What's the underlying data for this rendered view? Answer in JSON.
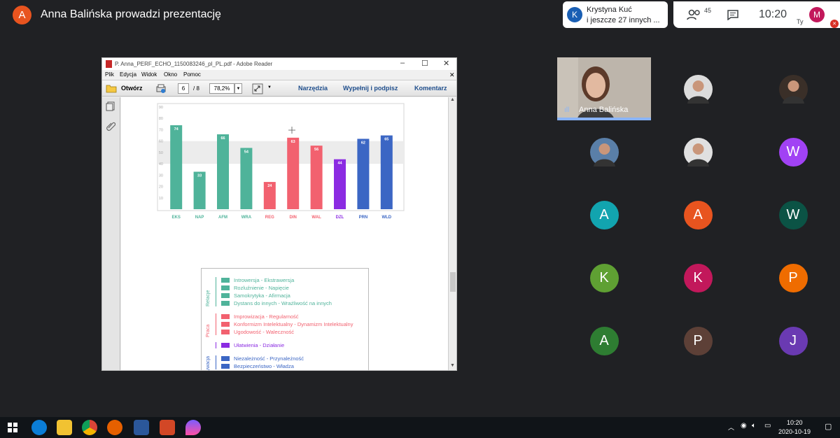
{
  "meet": {
    "presenter_initial": "A",
    "presenter_text": "Anna Balińska prowadzi prezentację",
    "notification": {
      "initial": "K",
      "line1": "Krystyna Kuć",
      "line2": "i jeszcze 27 innych ..."
    },
    "people_count": "45",
    "clock": "10:20",
    "self_initial": "M",
    "self_label": "Ty"
  },
  "reader": {
    "title": "P. Anna_PERF_ECHO_1150083246_pl_PL.pdf - Adobe Reader",
    "menu": [
      "Plik",
      "Edycja",
      "Widok",
      "Okno",
      "Pomoc"
    ],
    "open_label": "Otwórz",
    "page_current": "6",
    "page_total": "/ 8",
    "zoom": "78,2%",
    "tools_label": "Narzędzia",
    "fill_sign_label": "Wypełnij i podpisz",
    "comment_label": "Komentarz"
  },
  "chart_data": {
    "type": "bar",
    "categories": [
      "EKS",
      "NAP",
      "AFM",
      "WRA",
      "REG",
      "DIN",
      "WAL",
      "DZL",
      "PRN",
      "WLD"
    ],
    "values": [
      74,
      33,
      66,
      54,
      24,
      63,
      56,
      44,
      62,
      65
    ],
    "colors": [
      "#4fb39a",
      "#4fb39a",
      "#4fb39a",
      "#4fb39a",
      "#f2616f",
      "#f2616f",
      "#f2616f",
      "#8b2be2",
      "#3b66c4",
      "#3b66c4"
    ],
    "yticks": [
      10,
      20,
      30,
      40,
      50,
      60,
      70,
      80,
      90
    ],
    "ylim": [
      0,
      90
    ],
    "band": [
      40,
      60
    ],
    "grid": false
  },
  "legend": {
    "groups": [
      {
        "name": "Relacje",
        "color": "#4fb39a",
        "items": [
          "Introwersja - Ekstrawersja",
          "Rozluźnienie - Napięcie",
          "Samokrytyka - Afirmacja",
          "Dystans do innych - Wrażliwość na innych"
        ]
      },
      {
        "name": "Praca",
        "color": "#f2616f",
        "items": [
          "Improwizacja - Regularność",
          "Konformizm Intelektualny - Dynamizm Intelektualny",
          "Ugodowość - Waleczność"
        ]
      },
      {
        "name": "",
        "color": "#8b2be2",
        "items": [
          "Ułatwienia - Działanie"
        ]
      },
      {
        "name": "Motywacja",
        "color": "#3b66c4",
        "items": [
          "Niezależność - Przynależność",
          "Bezpieczeństwo - Władza"
        ]
      }
    ]
  },
  "participants": {
    "speaker": "Anna Balińska",
    "tiles": [
      {
        "initial": "",
        "color": "#dcdcdc",
        "photo": true
      },
      {
        "initial": "",
        "color": "#3a2f28",
        "photo": true
      },
      {
        "initial": "",
        "color": "#5a7fa8",
        "photo": true
      },
      {
        "initial": "",
        "color": "#e0e0e0",
        "photo": true
      },
      {
        "initial": "W",
        "color": "#a142f4"
      },
      {
        "initial": "A",
        "color": "#12a4af"
      },
      {
        "initial": "A",
        "color": "#e8541f"
      },
      {
        "initial": "W",
        "color": "#0b5345"
      },
      {
        "initial": "K",
        "color": "#5fa033"
      },
      {
        "initial": "K",
        "color": "#c2185b"
      },
      {
        "initial": "P",
        "color": "#ef6c00"
      },
      {
        "initial": "A",
        "color": "#2e7d32"
      },
      {
        "initial": "P",
        "color": "#5d4037"
      },
      {
        "initial": "J",
        "color": "#6a3ab2"
      }
    ]
  },
  "taskbar": {
    "time": "10:20",
    "date": "2020-10-19"
  }
}
